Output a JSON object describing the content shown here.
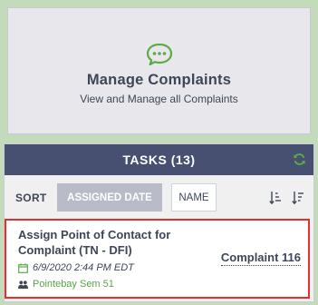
{
  "manage_card": {
    "title": "Manage Complaints",
    "subtitle": "View and Manage all Complaints",
    "icon": "chat-bubble-icon",
    "icon_color": "#5bab46"
  },
  "tasks": {
    "header": "TASKS (13)",
    "refresh_icon": "refresh-icon",
    "header_color": "#475070",
    "sort": {
      "label": "SORT",
      "options": [
        {
          "label": "ASSIGNED DATE",
          "active": true
        },
        {
          "label": "NAME",
          "active": false
        }
      ],
      "icons": [
        "sort-ascending-icon",
        "sort-descending-icon"
      ]
    },
    "items": [
      {
        "title": "Assign Point of Contact for Complaint (TN - DFI)",
        "date": "6/9/2020 2:44 PM EDT",
        "team": "Pointebay Sem 51",
        "link": "Complaint 116",
        "highlight_color": "#e52f2f"
      }
    ]
  }
}
